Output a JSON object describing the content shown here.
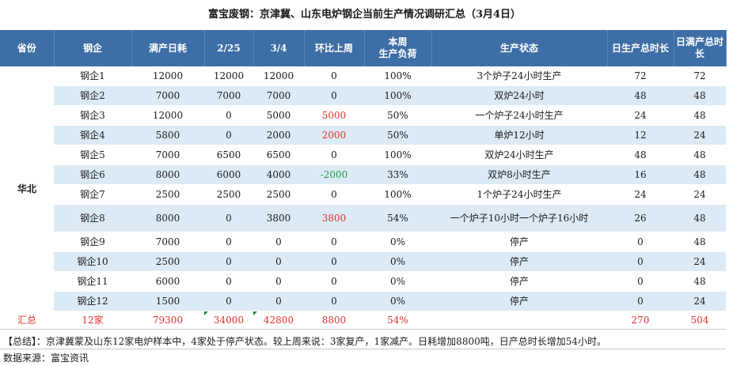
{
  "title": "富宝废钢：京津冀、山东电炉钢企当前生产情况调研汇总（3月4日）",
  "headers": [
    "省份",
    "钢企",
    "满产日耗",
    "2/25",
    "3/4",
    "环比上周",
    "本周\n生产负荷",
    "生产状态",
    "日生产总时长",
    "日满产总时长"
  ],
  "province": "华北",
  "rows": [
    {
      "name": "钢企1",
      "full": "12000",
      "d0225": "12000",
      "d0304": "12000",
      "change": "0",
      "change_color": "normal",
      "load": "100%",
      "status": "3个炉子24小时生产",
      "hours": "72",
      "full_hours": "72"
    },
    {
      "name": "钢企2",
      "full": "7000",
      "d0225": "7000",
      "d0304": "7000",
      "change": "0",
      "change_color": "normal",
      "load": "100%",
      "status": "双炉24小时",
      "hours": "48",
      "full_hours": "48"
    },
    {
      "name": "钢企3",
      "full": "12000",
      "d0225": "0",
      "d0304": "5000",
      "change": "5000",
      "change_color": "red",
      "load": "50%",
      "status": "一个炉子24小时生产",
      "hours": "24",
      "full_hours": "48"
    },
    {
      "name": "钢企4",
      "full": "5800",
      "d0225": "0",
      "d0304": "2000",
      "change": "2000",
      "change_color": "red",
      "load": "50%",
      "status": "单炉12小时",
      "hours": "12",
      "full_hours": "24"
    },
    {
      "name": "钢企5",
      "full": "7000",
      "d0225": "6500",
      "d0304": "6500",
      "change": "0",
      "change_color": "normal",
      "load": "100%",
      "status": "双炉24小时生产",
      "hours": "48",
      "full_hours": "48"
    },
    {
      "name": "钢企6",
      "full": "8000",
      "d0225": "6000",
      "d0304": "4000",
      "change": "-2000",
      "change_color": "green",
      "load": "33%",
      "status": "双炉8小时生产",
      "hours": "16",
      "full_hours": "48"
    },
    {
      "name": "钢企7",
      "full": "2500",
      "d0225": "2500",
      "d0304": "2500",
      "change": "0",
      "change_color": "normal",
      "load": "100%",
      "status": "1个炉子24小时生产",
      "hours": "24",
      "full_hours": "24"
    },
    {
      "name": "钢企8",
      "full": "8000",
      "d0225": "0",
      "d0304": "3800",
      "change": "3800",
      "change_color": "red",
      "load": "54%",
      "status": "一个炉子10小时一个炉子16小时",
      "hours": "26",
      "full_hours": "48"
    },
    {
      "name": "钢企9",
      "full": "7000",
      "d0225": "0",
      "d0304": "0",
      "change": "0",
      "change_color": "normal",
      "load": "0%",
      "status": "停产",
      "hours": "0",
      "full_hours": "48"
    },
    {
      "name": "钢企10",
      "full": "2500",
      "d0225": "0",
      "d0304": "0",
      "change": "0",
      "change_color": "normal",
      "load": "0%",
      "status": "停产",
      "hours": "0",
      "full_hours": "24"
    },
    {
      "name": "钢企11",
      "full": "6000",
      "d0225": "0",
      "d0304": "0",
      "change": "0",
      "change_color": "normal",
      "load": "0%",
      "status": "停产",
      "hours": "0",
      "full_hours": "48"
    },
    {
      "name": "钢企12",
      "full": "1500",
      "d0225": "0",
      "d0304": "0",
      "change": "0",
      "change_color": "normal",
      "load": "0%",
      "status": "停产",
      "hours": "0",
      "full_hours": "24"
    }
  ],
  "total": {
    "label": "汇总",
    "name": "12家",
    "full": "79300",
    "d0225": "34000",
    "d0304": "42800",
    "change": "8800",
    "load": "54%",
    "status": "",
    "hours": "270",
    "full_hours": "504"
  },
  "summary": "【总结】：京津冀蒙及山东12家电炉样本中，4家处于停产状态。较上周来说：3家复产，1家减产。日耗增加8800吨，日产总时长增加54小时。",
  "source": "数据来源：富宝资讯",
  "colors": {
    "header_bg": "#3d6ea5",
    "stripe": "#dceaf5",
    "up": "#e03030",
    "down": "#1f9a3a"
  }
}
